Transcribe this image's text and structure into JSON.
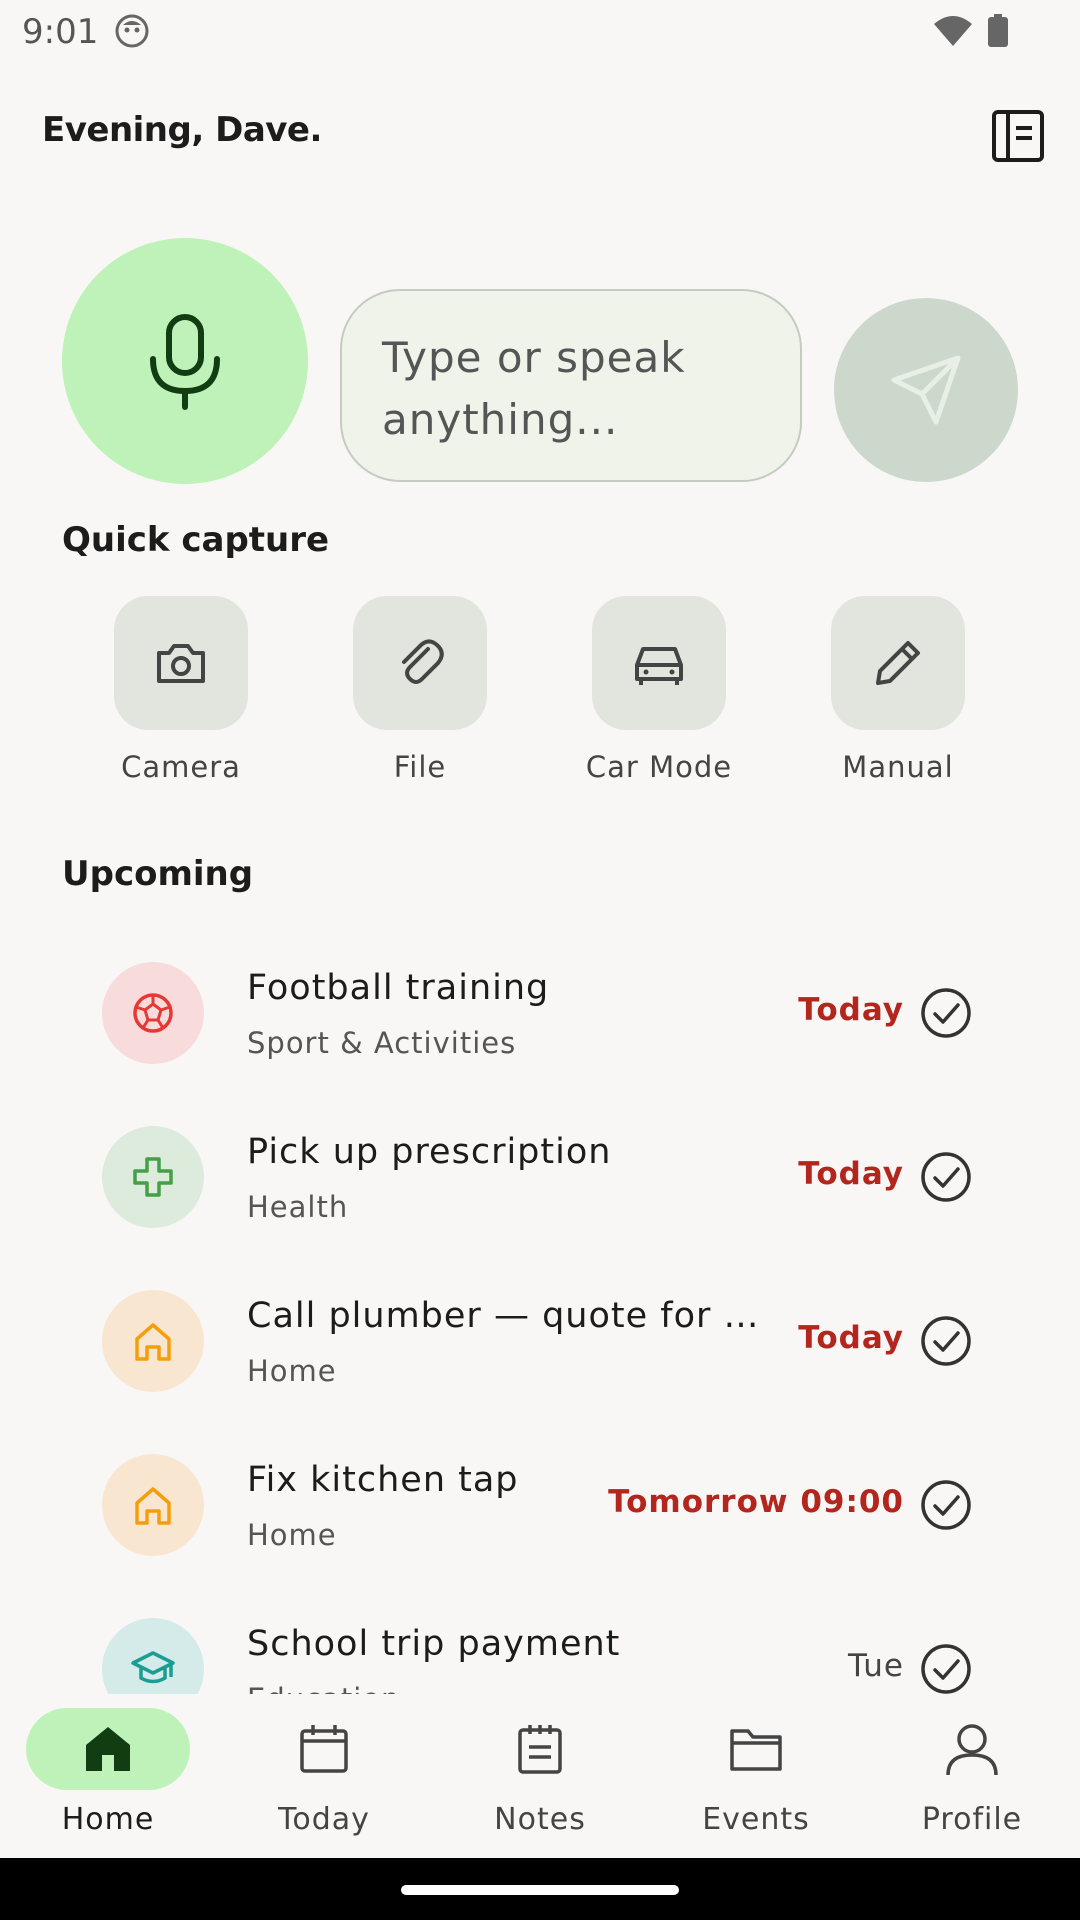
{
  "status_bar": {
    "time": "9:01",
    "icons": [
      "avatar-icon",
      "wifi-icon",
      "battery-icon"
    ]
  },
  "header": {
    "greeting": "Evening, Dave.",
    "journal_icon": "journal-icon"
  },
  "composer": {
    "mic_icon": "mic-icon",
    "placeholder": "Type or speak anything...",
    "send_icon": "send-icon"
  },
  "quick_capture": {
    "title": "Quick capture",
    "items": [
      {
        "label": "Camera",
        "icon": "camera-icon"
      },
      {
        "label": "File",
        "icon": "paperclip-icon"
      },
      {
        "label": "Car Mode",
        "icon": "car-icon"
      },
      {
        "label": "Manual",
        "icon": "pencil-icon"
      }
    ]
  },
  "upcoming": {
    "title": "Upcoming",
    "items": [
      {
        "title": "Football training",
        "subtitle": "Sport & Activities",
        "due": "Today",
        "icon": "football-icon",
        "icon_color": "#e53935",
        "bg": "#f7dcdb"
      },
      {
        "title": "Pick up prescription",
        "subtitle": "Health",
        "due": "Today",
        "icon": "medical-cross-icon",
        "icon_color": "#43a047",
        "bg": "#dcebdc"
      },
      {
        "title": "Call plumber — quote for bat...",
        "subtitle": "Home",
        "due": "Today",
        "icon": "home-icon",
        "icon_color": "#f59e0b",
        "bg": "#f9e6d1"
      },
      {
        "title": "Fix kitchen tap",
        "subtitle": "Home",
        "due": "Tomorrow 09:00",
        "icon": "home-icon",
        "icon_color": "#f59e0b",
        "bg": "#f9e6d1"
      },
      {
        "title": "School trip payment",
        "subtitle": "Education",
        "due": "Tue",
        "icon": "graduation-cap-icon",
        "icon_color": "#1a9e94",
        "bg": "#d5ebe9"
      }
    ],
    "due_color": "#b3261e"
  },
  "bottom_nav": {
    "items": [
      {
        "label": "Home",
        "icon": "home-icon",
        "active": true
      },
      {
        "label": "Today",
        "icon": "calendar-icon",
        "active": false
      },
      {
        "label": "Notes",
        "icon": "notepad-icon",
        "active": false
      },
      {
        "label": "Events",
        "icon": "folder-icon",
        "active": false
      },
      {
        "label": "Profile",
        "icon": "person-icon",
        "active": false
      }
    ]
  },
  "colors": {
    "accent": "#bff2b9",
    "background": "#f8f7f6"
  }
}
